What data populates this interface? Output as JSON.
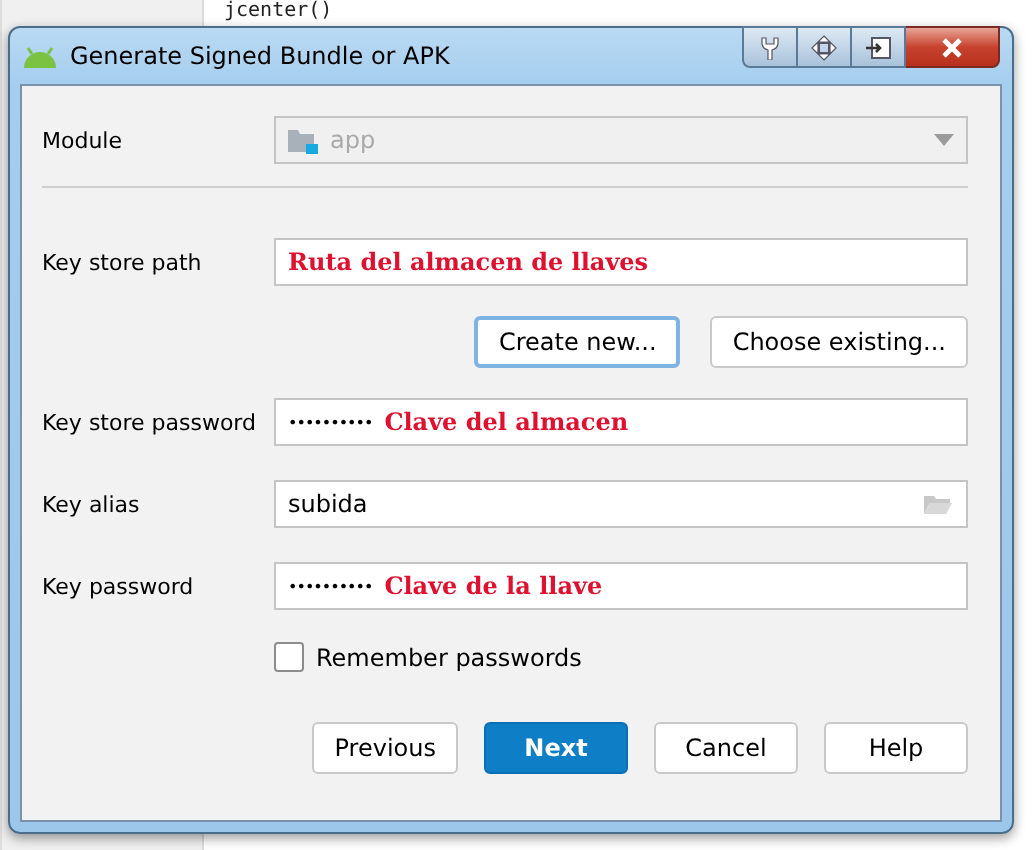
{
  "background_editor": {
    "code_line": "jcenter()"
  },
  "window": {
    "title": "Generate Signed Bundle or APK"
  },
  "module": {
    "label": "Module",
    "value": "app",
    "disabled": true
  },
  "fields": [
    {
      "kind": "text",
      "label": "Key store path",
      "annotation": "Ruta del almacen de llaves"
    },
    {
      "kind": "buttons",
      "buttons": [
        {
          "label": "Create new...",
          "focused": true
        },
        {
          "label": "Choose existing...",
          "focused": false
        }
      ]
    },
    {
      "kind": "password",
      "label": "Key store password",
      "value": "••••••••••",
      "annotation": "Clave del almacen"
    },
    {
      "kind": "browse",
      "label": "Key alias",
      "value": "subida"
    },
    {
      "kind": "password",
      "label": "Key password",
      "value": "••••••••••",
      "annotation": "Clave de la llave"
    }
  ],
  "remember": {
    "label": "Remember passwords",
    "checked": false
  },
  "buttons": [
    {
      "label": "Previous",
      "primary": false
    },
    {
      "label": "Next",
      "primary": true
    },
    {
      "label": "Cancel",
      "primary": false
    },
    {
      "label": "Help",
      "primary": false
    }
  ]
}
